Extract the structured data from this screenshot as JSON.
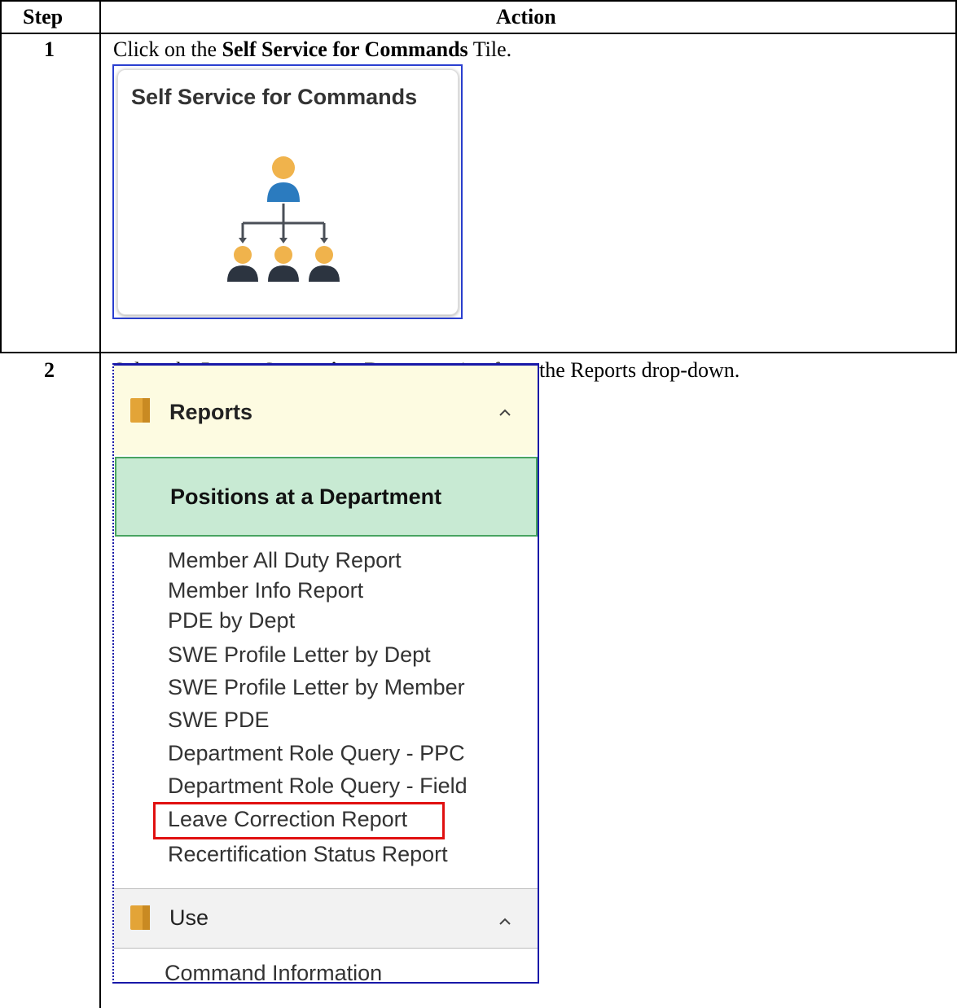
{
  "table": {
    "header_step": "Step",
    "header_action": "Action"
  },
  "rows": [
    {
      "step": "1",
      "text_pre": "Click on the ",
      "text_bold": "Self Service for Commands",
      "text_post": " Tile."
    },
    {
      "step": "2",
      "text_pre": "Select the ",
      "text_bold": "Leave Correction Report",
      "text_post": " option from the Reports drop-down."
    }
  ],
  "tile": {
    "title": "Self Service for Commands",
    "icon": "org-chart-icon",
    "frame_color": "#2a3fd0",
    "person_head_color": "#f0b34c",
    "person_body_top_color": "#2b7bbf",
    "person_body_bottom_color": "#2c3440"
  },
  "menu": {
    "section_label": "Reports",
    "section_icon": "folder-icon",
    "selected_item": "Positions at a Department",
    "items": [
      "Member All Duty Report",
      "Member Info Report",
      "PDE by Dept",
      "SWE Profile Letter by Dept",
      "SWE Profile Letter by Member",
      "SWE PDE",
      "Department Role Query - PPC",
      "Department Role Query - Field",
      "Leave Correction Report",
      "Recertification Status Report"
    ],
    "highlighted_item": "Leave Correction Report",
    "use_section_label": "Use",
    "use_items": [
      "Command Information"
    ],
    "highlight_color": "#e01010",
    "selected_bg": "#c8ead3"
  }
}
